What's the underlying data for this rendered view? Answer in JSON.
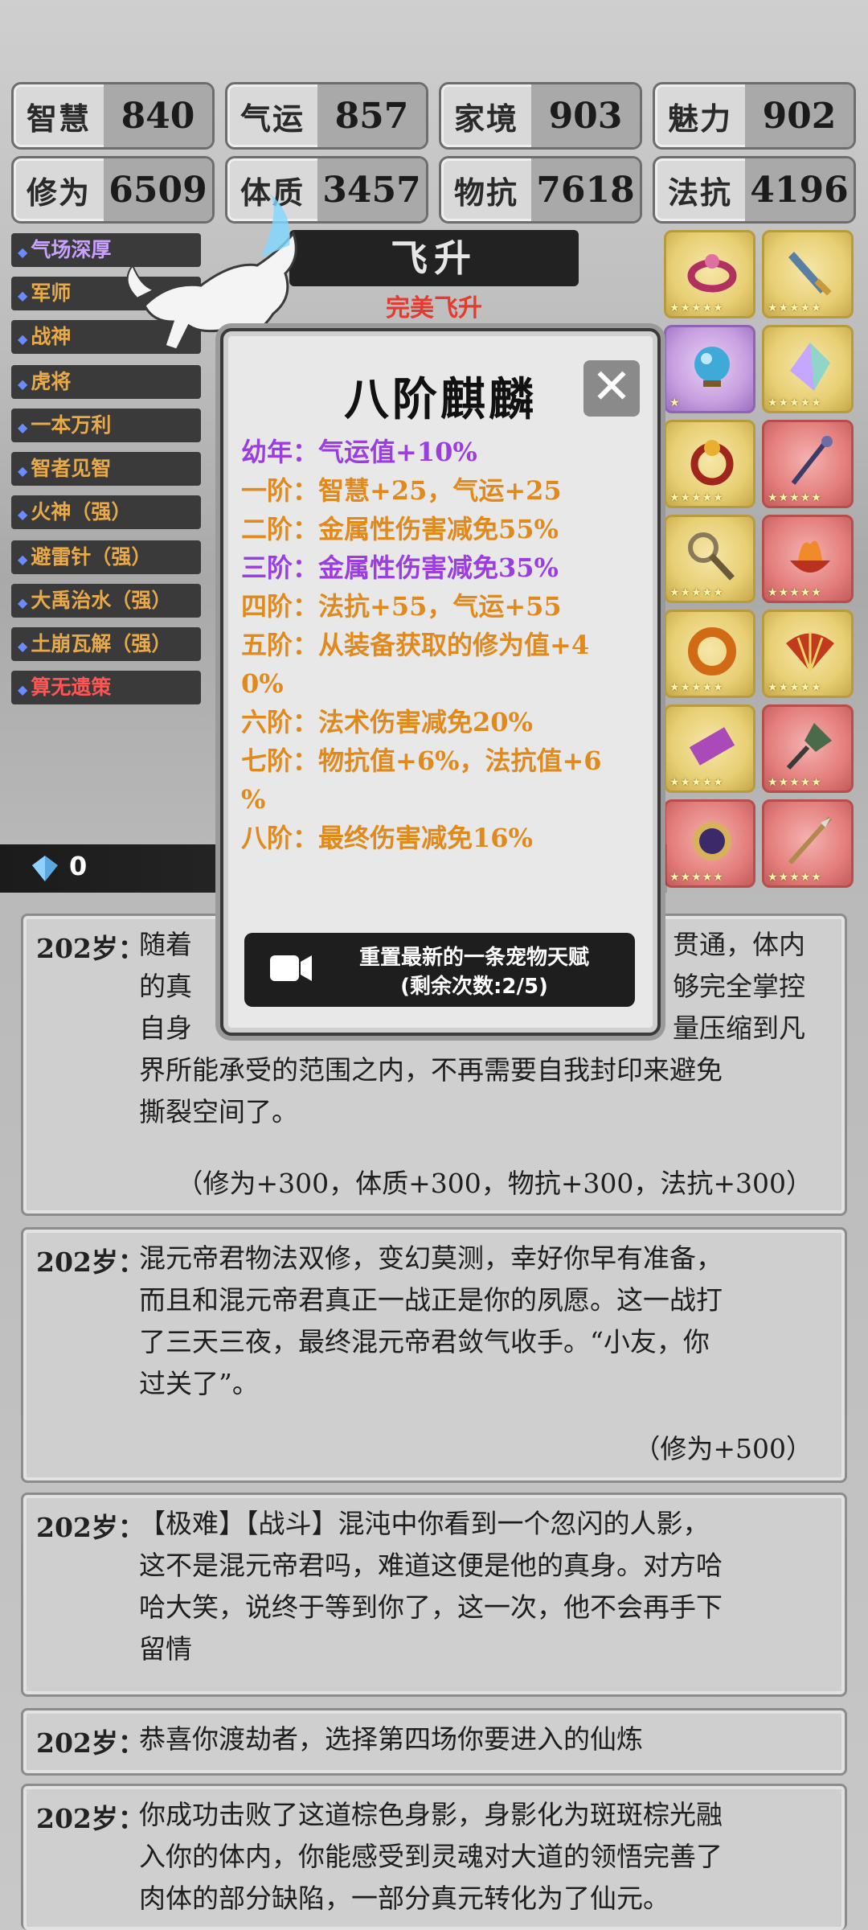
{
  "stats": [
    {
      "label": "智慧",
      "value": "840"
    },
    {
      "label": "气运",
      "value": "857"
    },
    {
      "label": "家境",
      "value": "903"
    },
    {
      "label": "魅力",
      "value": "902"
    },
    {
      "label": "修为",
      "value": "6509"
    },
    {
      "label": "体质",
      "value": "3457"
    },
    {
      "label": "物抗",
      "value": "7618"
    },
    {
      "label": "法抗",
      "value": "4196"
    }
  ],
  "buffs": [
    {
      "label": "气场深厚",
      "style": "purple"
    },
    {
      "label": "军师",
      "style": "gold"
    },
    {
      "label": "战神",
      "style": "gold"
    },
    {
      "label": "虎将",
      "style": "gold"
    },
    {
      "label": "一本万利",
      "style": "gold"
    },
    {
      "label": "智者见智",
      "style": "gold"
    },
    {
      "label": "火神（强）",
      "style": "gold"
    },
    {
      "label": "避雷针（强）",
      "style": "gold"
    },
    {
      "label": "大禹治水（强）",
      "style": "gold"
    },
    {
      "label": "土崩瓦解（强）",
      "style": "gold"
    },
    {
      "label": "算无遗策",
      "style": "red"
    }
  ],
  "banner": {
    "title": "飞升",
    "subtitle": "完美飞升"
  },
  "currency": {
    "value": "0"
  },
  "equipment": [
    {
      "icon": "bracelet-icon",
      "style": "gold",
      "stars": 5
    },
    {
      "icon": "sword-hilt-icon",
      "style": "gold",
      "stars": 5
    },
    {
      "icon": "orb-icon",
      "style": "purple",
      "stars": 1
    },
    {
      "icon": "crystal-icon",
      "style": "gold",
      "stars": 5
    },
    {
      "icon": "ring-icon",
      "style": "gold",
      "stars": 5
    },
    {
      "icon": "staff-icon",
      "style": "red",
      "stars": 5
    },
    {
      "icon": "scepter-icon",
      "style": "gold",
      "stars": 5
    },
    {
      "icon": "flame-bowl-icon",
      "style": "red",
      "stars": 5
    },
    {
      "icon": "gold-ring-icon",
      "style": "gold",
      "stars": 5
    },
    {
      "icon": "fan-icon",
      "style": "gold",
      "stars": 5
    },
    {
      "icon": "scroll-icon",
      "style": "gold",
      "stars": 5
    },
    {
      "icon": "spade-icon",
      "style": "red",
      "stars": 5
    },
    {
      "icon": "mirror-icon",
      "style": "red",
      "stars": 5
    },
    {
      "icon": "spear-icon",
      "style": "red",
      "stars": 5
    }
  ],
  "modal": {
    "title": "八阶麒麟",
    "close_icon": "close-icon",
    "traits": [
      {
        "text": "幼年：气运值+10%",
        "color": "purple"
      },
      {
        "text": "一阶：智慧+25，气运+25",
        "color": "orange"
      },
      {
        "text": "二阶：金属性伤害减免55%",
        "color": "orange"
      },
      {
        "text": "三阶：金属性伤害减免35%",
        "color": "purple"
      },
      {
        "text": "四阶：法抗+55，气运+55",
        "color": "orange"
      },
      {
        "text": "五阶：从装备获取的修为值+4",
        "color": "orange"
      },
      {
        "text": "0%",
        "color": "orange"
      },
      {
        "text": "六阶：法术伤害减免20%",
        "color": "orange"
      },
      {
        "text": "七阶：物抗值+6%，法抗值+6",
        "color": "orange"
      },
      {
        "text": "%",
        "color": "orange"
      },
      {
        "text": "八阶：最终伤害减免16%",
        "color": "orange"
      }
    ],
    "reset_line1": "重置最新的一条宠物天赋",
    "reset_line2": "(剩余次数:2/5)"
  },
  "events": [
    {
      "age": "202岁：",
      "lines": [
        "随着",
        "的真",
        "自身",
        "界所能承受的范围之内，不再需要自我封印来避免",
        "撕裂空间了。"
      ],
      "right_lines": [
        "贯通，体内",
        "够完全掌控",
        "量压缩到凡"
      ],
      "reward": "（修为+300，体质+300，物抗+300，法抗+300）"
    },
    {
      "age": "202岁：",
      "lines": [
        "混元帝君物法双修，变幻莫测，幸好你早有准备，",
        "而且和混元帝君真正一战正是你的夙愿。这一战打",
        "了三天三夜，最终混元帝君敛气收手。“小友，你",
        "过关了”。"
      ],
      "reward": "（修为+500）"
    },
    {
      "age": "202岁：",
      "lines": [
        "【极难】【战斗】混沌中你看到一个忽闪的人影，",
        "这不是混元帝君吗，难道这便是他的真身。对方哈",
        "哈大笑，说终于等到你了，这一次，他不会再手下",
        "留情"
      ]
    },
    {
      "age": "202岁：",
      "lines": [
        "恭喜你渡劫者，选择第四场你要进入的仙炼"
      ]
    },
    {
      "age": "202岁：",
      "lines": [
        "你成功击败了这道棕色身影，身影化为斑斑棕光融",
        "入你的体内，你能感受到灵魂对大道的领悟完善了",
        "肉体的部分缺陷，一部分真元转化为了仙元。"
      ]
    }
  ]
}
